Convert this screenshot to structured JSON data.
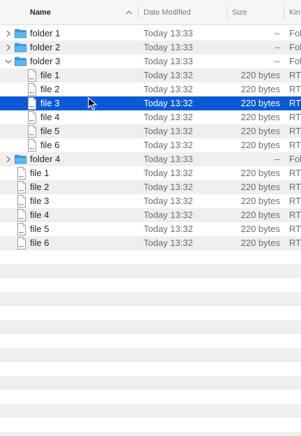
{
  "header": {
    "name_label": "Name",
    "date_label": "Date Modified",
    "size_label": "Size",
    "kind_label": "Kin"
  },
  "rows": [
    {
      "type": "folder",
      "indent": 0,
      "expanded": false,
      "name": "folder 1",
      "date": "Today 13:33",
      "size": "--",
      "kind": "Fol"
    },
    {
      "type": "folder",
      "indent": 0,
      "expanded": false,
      "name": "folder 2",
      "date": "Today 13:33",
      "size": "--",
      "kind": "Fol"
    },
    {
      "type": "folder",
      "indent": 0,
      "expanded": true,
      "name": "folder 3",
      "date": "Today 13:33",
      "size": "--",
      "kind": "Fol"
    },
    {
      "type": "file",
      "indent": 1,
      "name": "file 1",
      "date": "Today 13:32",
      "size": "220 bytes",
      "kind": "RT"
    },
    {
      "type": "file",
      "indent": 1,
      "name": "file 2",
      "date": "Today 13:32",
      "size": "220 bytes",
      "kind": "RT"
    },
    {
      "type": "file",
      "indent": 1,
      "name": "file 3",
      "date": "Today 13:32",
      "size": "220 bytes",
      "kind": "RT",
      "selected": true
    },
    {
      "type": "file",
      "indent": 1,
      "name": "file 4",
      "date": "Today 13:32",
      "size": "220 bytes",
      "kind": "RT"
    },
    {
      "type": "file",
      "indent": 1,
      "name": "file 5",
      "date": "Today 13:32",
      "size": "220 bytes",
      "kind": "RT"
    },
    {
      "type": "file",
      "indent": 1,
      "name": "file 6",
      "date": "Today 13:32",
      "size": "220 bytes",
      "kind": "RT"
    },
    {
      "type": "folder",
      "indent": 0,
      "expanded": false,
      "name": "folder 4",
      "date": "Today 13:33",
      "size": "--",
      "kind": "Fol"
    },
    {
      "type": "file",
      "indent": 0,
      "name": "file 1",
      "date": "Today 13:32",
      "size": "220 bytes",
      "kind": "RT"
    },
    {
      "type": "file",
      "indent": 0,
      "name": "file 2",
      "date": "Today 13:32",
      "size": "220 bytes",
      "kind": "RT"
    },
    {
      "type": "file",
      "indent": 0,
      "name": "file 3",
      "date": "Today 13:32",
      "size": "220 bytes",
      "kind": "RT"
    },
    {
      "type": "file",
      "indent": 0,
      "name": "file 4",
      "date": "Today 13:32",
      "size": "220 bytes",
      "kind": "RT"
    },
    {
      "type": "file",
      "indent": 0,
      "name": "file 5",
      "date": "Today 13:32",
      "size": "220 bytes",
      "kind": "RT"
    },
    {
      "type": "file",
      "indent": 0,
      "name": "file 6",
      "date": "Today 13:32",
      "size": "220 bytes",
      "kind": "RT"
    }
  ],
  "colors": {
    "selection": "#0a5ad6",
    "folder": "#3aa0e0",
    "stripe": "#efefef"
  },
  "icons": {
    "folder": "folder-icon",
    "file": "rtf-document-icon",
    "disclosure_closed": "chevron-right-icon",
    "disclosure_open": "chevron-down-icon",
    "sort": "sort-ascending-icon",
    "cursor": "mouse-pointer-icon"
  }
}
